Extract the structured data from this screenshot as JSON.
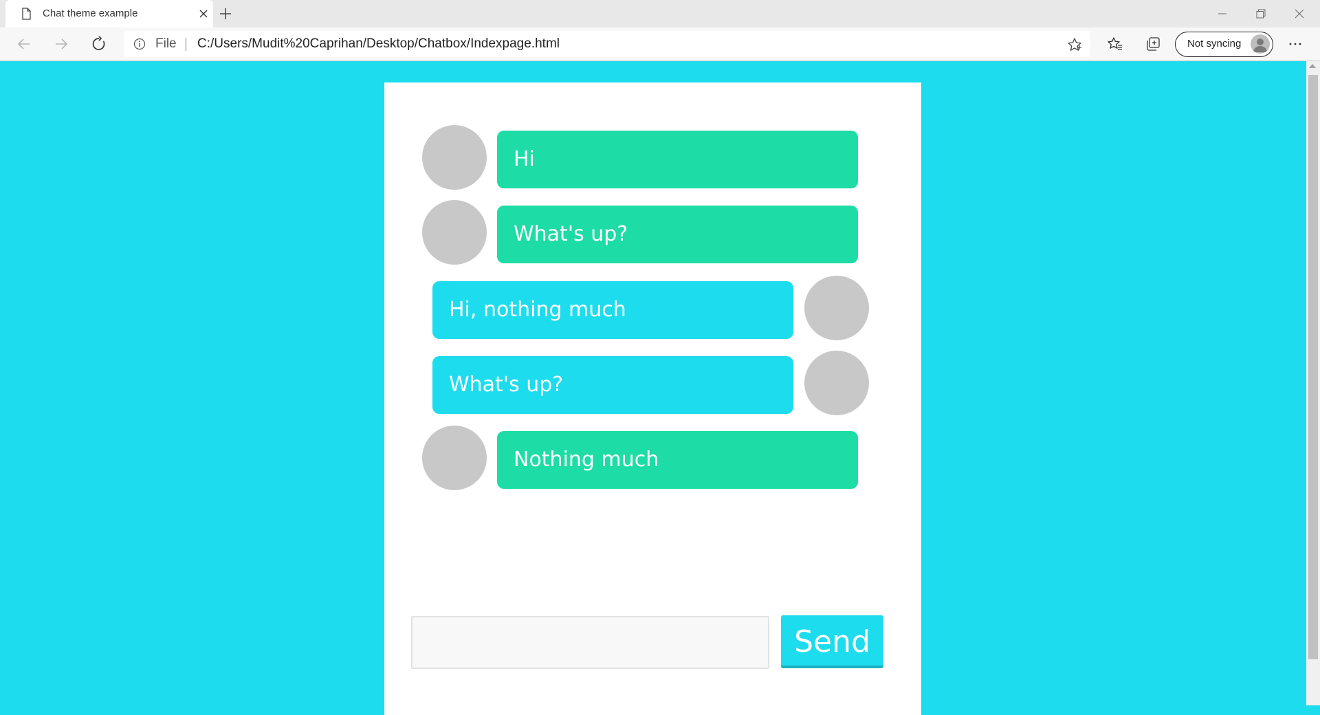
{
  "browser": {
    "tab": {
      "title": "Chat theme example",
      "icon": "page-icon",
      "close_icon": "close-icon"
    },
    "new_tab_icon": "plus-icon",
    "address": {
      "info_icon": "info-icon",
      "scheme": "File",
      "url": "C:/Users/Mudit%20Caprihan/Desktop/Chatbox/Indexpage.html",
      "favorite_icon": "star-icon"
    },
    "sync": {
      "label": "Not syncing",
      "avatar_icon": "profile-avatar-icon"
    }
  },
  "chat": {
    "messages": [
      {
        "text": "Hi",
        "side": "left",
        "color": "#1ddca5"
      },
      {
        "text": "What's up?",
        "side": "left",
        "color": "#1ddca5"
      },
      {
        "text": "Hi, nothing much",
        "side": "right",
        "color": "#1ddced"
      },
      {
        "text": "What's up?",
        "side": "right",
        "color": "#1ddced"
      },
      {
        "text": "Nothing much",
        "side": "left",
        "color": "#1ddca5"
      }
    ],
    "compose": {
      "value": "",
      "send_label": "Send"
    }
  },
  "colors": {
    "page_background": "#1ddced",
    "panel_background": "#ffffff",
    "bubble_green": "#1ddca5",
    "bubble_cyan": "#1ddced",
    "avatar_gray": "#c8c8c8"
  }
}
